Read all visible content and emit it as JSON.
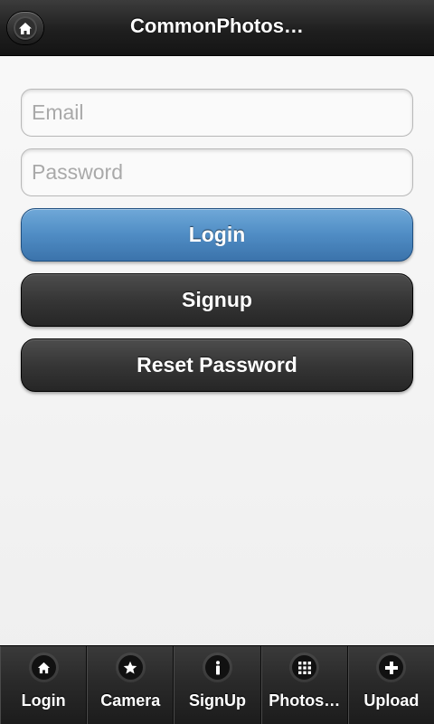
{
  "header": {
    "title": "CommonPhotos…",
    "home_icon": "home-icon"
  },
  "form": {
    "email_placeholder": "Email",
    "email_value": "",
    "password_placeholder": "Password",
    "password_value": "",
    "login_label": "Login",
    "signup_label": "Signup",
    "reset_label": "Reset Password"
  },
  "colors": {
    "primary_button": "#4f8cc4",
    "dark_button": "#363636",
    "header_bg": "#1f1f1f"
  },
  "footer": {
    "items": [
      {
        "label": "Login",
        "icon": "home-icon"
      },
      {
        "label": "Camera",
        "icon": "star-icon"
      },
      {
        "label": "SignUp",
        "icon": "info-icon"
      },
      {
        "label": "Photos…",
        "icon": "grid-icon"
      },
      {
        "label": "Upload",
        "icon": "plus-icon"
      }
    ]
  }
}
